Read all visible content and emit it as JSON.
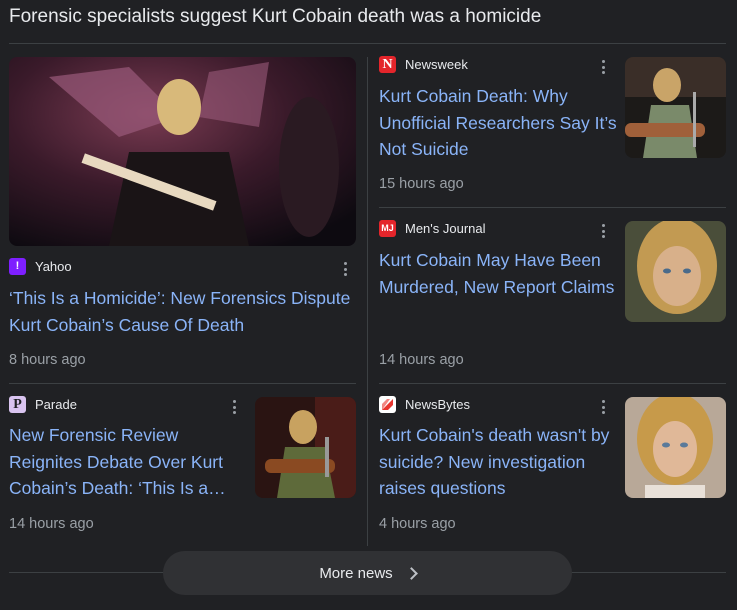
{
  "heading": "Forensic specialists suggest Kurt Cobain death was a homicide",
  "articles": [
    {
      "source": "Yahoo",
      "favicon_glyph": "!",
      "favicon_color": "#7e1fff",
      "title": "‘This Is a Homicide’: New Forensics Dispute Kurt Cobain’s Cause Of Death",
      "time": "8 hours ago",
      "thumbnail_icon": "guitarist-on-stage-photo"
    },
    {
      "source": "Newsweek",
      "favicon_glyph": "N",
      "favicon_color": "#e4252b",
      "title": "Kurt Cobain Death: Why Unofficial Researchers Say It’s Not Suicide",
      "time": "15 hours ago",
      "thumbnail_icon": "acoustic-performance-photo"
    },
    {
      "source": "Men's Journal",
      "favicon_glyph": "MJ",
      "favicon_color": "#e4252b",
      "title": "Kurt Cobain May Have Been Murdered, New Report Claims",
      "time": "14 hours ago",
      "thumbnail_icon": "portrait-photo"
    },
    {
      "source": "Parade",
      "favicon_glyph": "P",
      "favicon_color": "#d9c4f0",
      "title_lines": [
        "New Forensic Review",
        "Reignites Debate Over Kurt",
        "Cobain’s Death: ‘This Is a…"
      ],
      "time": "14 hours ago",
      "thumbnail_icon": "acoustic-performance-photo"
    },
    {
      "source": "NewsBytes",
      "favicon_glyph": "",
      "favicon_color": "#e8352f",
      "title": "Kurt Cobain's death wasn't by suicide? New investigation raises questions",
      "time": "4 hours ago",
      "thumbnail_icon": "portrait-photo"
    }
  ],
  "more_news": "More news"
}
